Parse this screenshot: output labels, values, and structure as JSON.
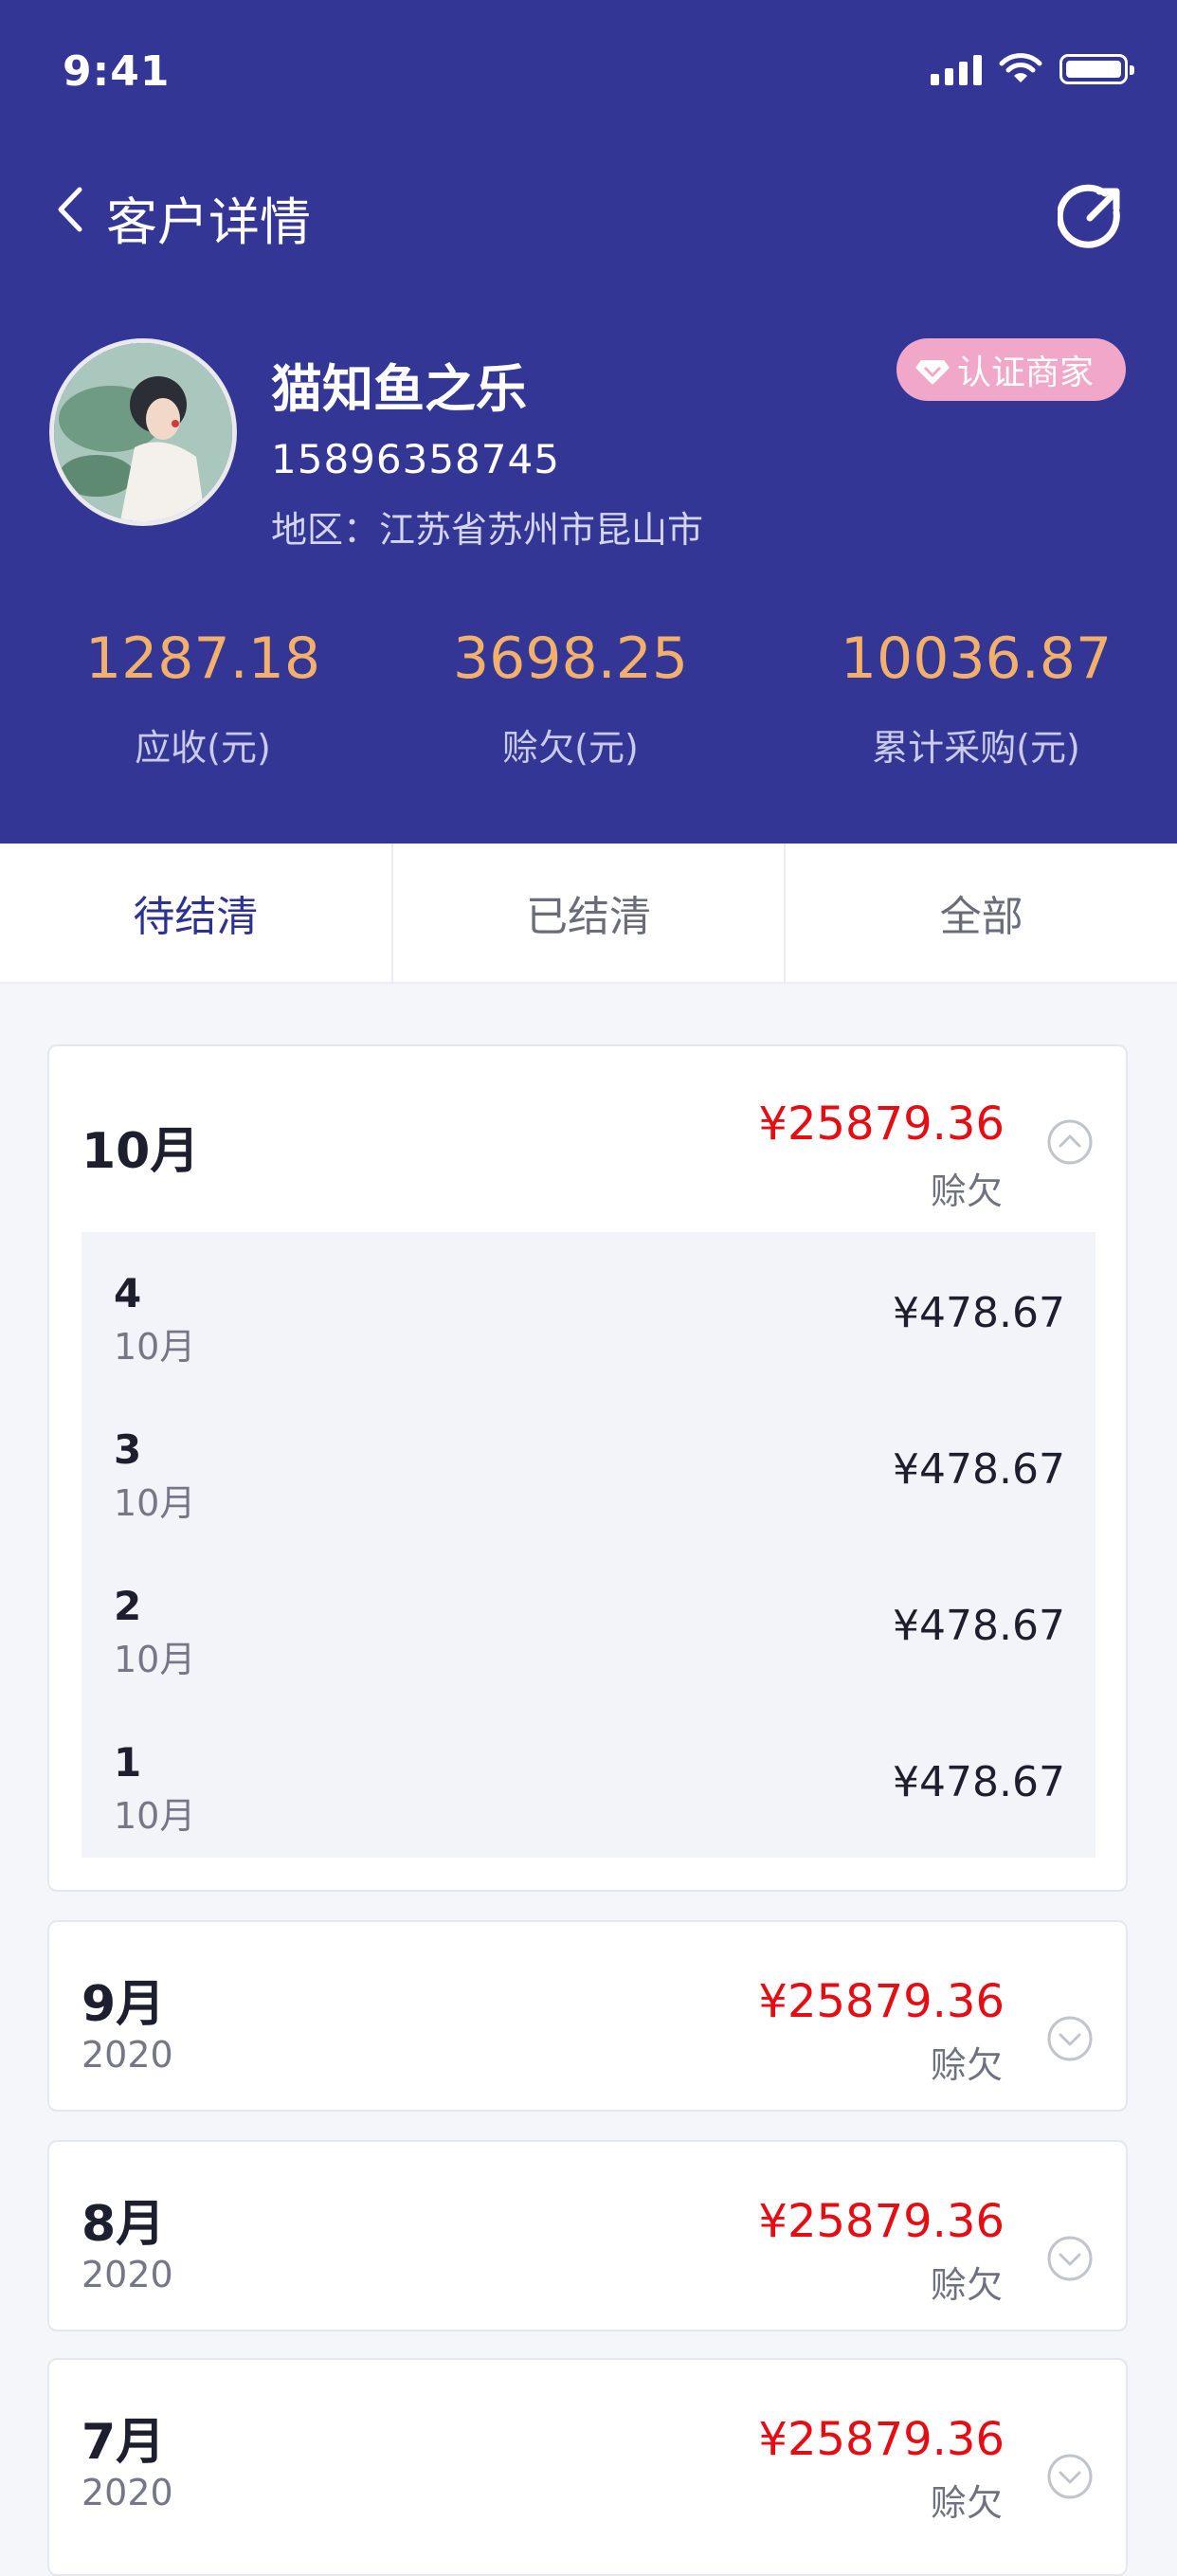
{
  "status_bar": {
    "time": "9:41"
  },
  "nav": {
    "title": "客户详情"
  },
  "customer": {
    "name": "猫知鱼之乐",
    "phone": "15896358745",
    "region": "地区：江苏省苏州市昆山市",
    "badge": "认证商家"
  },
  "stats": [
    {
      "value": "1287.18",
      "label": "应收(元)"
    },
    {
      "value": "3698.25",
      "label": "赊欠(元)"
    },
    {
      "value": "10036.87",
      "label": "累计采购(元)"
    }
  ],
  "tabs": [
    {
      "label": "待结清",
      "active": true
    },
    {
      "label": "已结清",
      "active": false
    },
    {
      "label": "全部",
      "active": false
    }
  ],
  "expanded_group": {
    "month": "10月",
    "amount": "¥25879.36",
    "amount_label": "赊欠",
    "items": [
      {
        "no": "4",
        "month": "10月",
        "amount": "¥478.67"
      },
      {
        "no": "3",
        "month": "10月",
        "amount": "¥478.67"
      },
      {
        "no": "2",
        "month": "10月",
        "amount": "¥478.67"
      },
      {
        "no": "1",
        "month": "10月",
        "amount": "¥478.67"
      }
    ]
  },
  "groups": [
    {
      "month": "9月",
      "year": "2020",
      "amount": "¥25879.36",
      "amount_label": "赊欠"
    },
    {
      "month": "8月",
      "year": "2020",
      "amount": "¥25879.36",
      "amount_label": "赊欠"
    },
    {
      "month": "7月",
      "year": "2020",
      "amount": "¥25879.36",
      "amount_label": "赊欠"
    }
  ],
  "colors": {
    "header_bg": "#333694",
    "stat_value": "#f3b06b",
    "amount_red": "#e50d13",
    "badge_pink": "#f0a7c8",
    "active_tab": "#2d3190"
  }
}
